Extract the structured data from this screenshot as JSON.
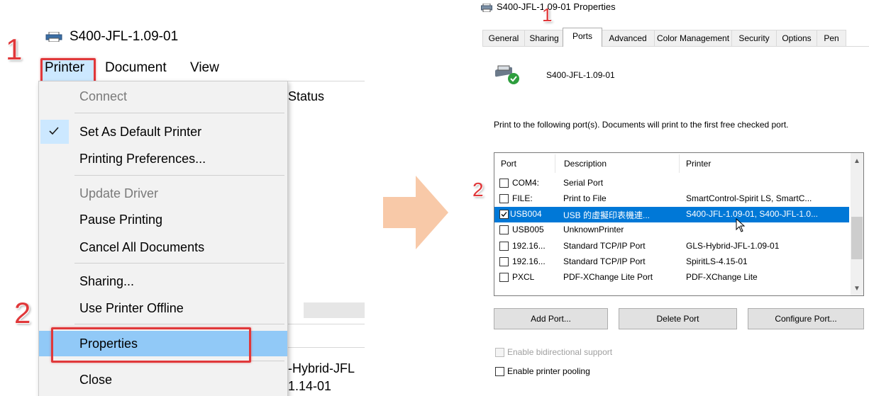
{
  "queue_window": {
    "title": "S400-JFL-1.09-01",
    "menubar": {
      "printer": "Printer",
      "document": "Document",
      "view": "View"
    },
    "status_header": "Status",
    "printer_menu": [
      {
        "label": "Connect",
        "disabled": true
      },
      {
        "label": "Set As Default Printer",
        "checked": true
      },
      {
        "label": "Printing Preferences..."
      },
      {
        "label": "Update Driver",
        "disabled": true
      },
      {
        "label": "Pause Printing"
      },
      {
        "label": "Cancel All Documents"
      },
      {
        "label": "Sharing..."
      },
      {
        "label": "Use Printer Offline"
      },
      {
        "label": "Properties",
        "highlighted": true
      },
      {
        "label": "Close"
      }
    ],
    "background_rows": {
      "row1": "-Hybrid-JFL",
      "row2": "1.14-01"
    }
  },
  "step_markers": {
    "left_1": "1",
    "left_2": "2",
    "right_1": "1",
    "right_2": "2"
  },
  "properties_dialog": {
    "title": "S400-JFL-1.09-01 Properties",
    "tabs": [
      "General",
      "Sharing",
      "Ports",
      "Advanced",
      "Color Management",
      "Security",
      "Options",
      "Pen"
    ],
    "active_tab": "Ports",
    "printer_name": "S400-JFL-1.09-01",
    "description": "Print to the following port(s). Documents will print to the first free checked port.",
    "columns": [
      "Port",
      "Description",
      "Printer"
    ],
    "ports": [
      {
        "port": "COM4:",
        "description": "Serial Port",
        "printer": "",
        "checked": false
      },
      {
        "port": "FILE:",
        "description": "Print to File",
        "printer": "SmartControl-Spirit LS, SmartC...",
        "checked": false
      },
      {
        "port": "USB004",
        "description": "USB 的虛擬印表機連...",
        "printer": "S400-JFL-1.09-01, S400-JFL-1.0...",
        "checked": true,
        "selected": true
      },
      {
        "port": "USB005",
        "description": "UnknownPrinter",
        "printer": "",
        "checked": false
      },
      {
        "port": "192.16...",
        "description": "Standard TCP/IP Port",
        "printer": "GLS-Hybrid-JFL-1.09-01",
        "checked": false
      },
      {
        "port": "192.16...",
        "description": "Standard TCP/IP Port",
        "printer": "SpiritLS-4.15-01",
        "checked": false
      },
      {
        "port": "PXCL",
        "description": "PDF-XChange Lite Port",
        "printer": "PDF-XChange Lite",
        "checked": false
      }
    ],
    "buttons": {
      "add_port": "Add Port...",
      "delete_port": "Delete Port",
      "configure_port": "Configure Port..."
    },
    "options": {
      "bidirectional": {
        "label": "Enable bidirectional support",
        "checked": false,
        "disabled": true
      },
      "pooling": {
        "label": "Enable printer pooling",
        "checked": false,
        "disabled": false
      }
    }
  },
  "colors": {
    "accent_red": "#e0383a",
    "selection_blue": "#0078d7",
    "menu_highlight": "#91c9f7",
    "arrow": "#f8c9a8"
  }
}
